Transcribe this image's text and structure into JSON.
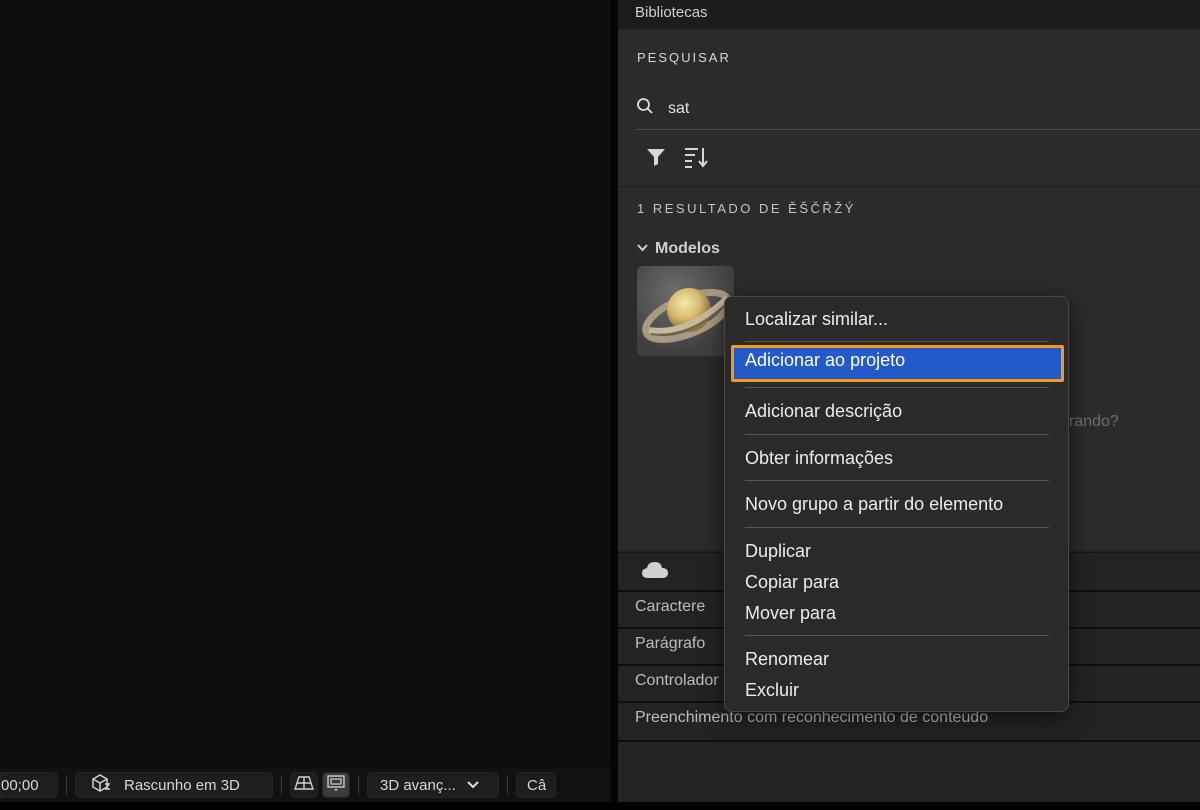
{
  "panel": {
    "title": "Bibliotecas",
    "search_section": "PESQUISAR",
    "search_value": "sat",
    "results_label": "1 RESULTADO DE ĚŠČŘŽÝ",
    "group_label": "Modelos",
    "hint_partial": "rando?"
  },
  "collapsed_panels": [
    "Caractere",
    "Parágrafo",
    "Controlador",
    "Preenchimento com reconhecimento de conteúdo"
  ],
  "viewer_toolbar": {
    "timecode": "00;00",
    "draft_label": "Rascunho em 3D",
    "renderer_label": "3D avanç...",
    "camera_label": "Câ"
  },
  "context_menu": {
    "items": [
      "Localizar similar...",
      "Adicionar ao projeto",
      "Adicionar descrição",
      "Obter informações",
      "Novo grupo a partir do elemento",
      "Duplicar",
      "Copiar para",
      "Mover para",
      "Renomear",
      "Excluir"
    ],
    "highlighted_index": 1
  },
  "colors": {
    "highlight": "#2359c9",
    "focus_ring": "#f29a1f"
  },
  "icons": [
    "search-icon",
    "filter-icon",
    "sort-icon",
    "chevron-down-icon",
    "cloud-icon",
    "draft-3d-icon",
    "ground-plane-icon",
    "view-toggle-icon"
  ]
}
